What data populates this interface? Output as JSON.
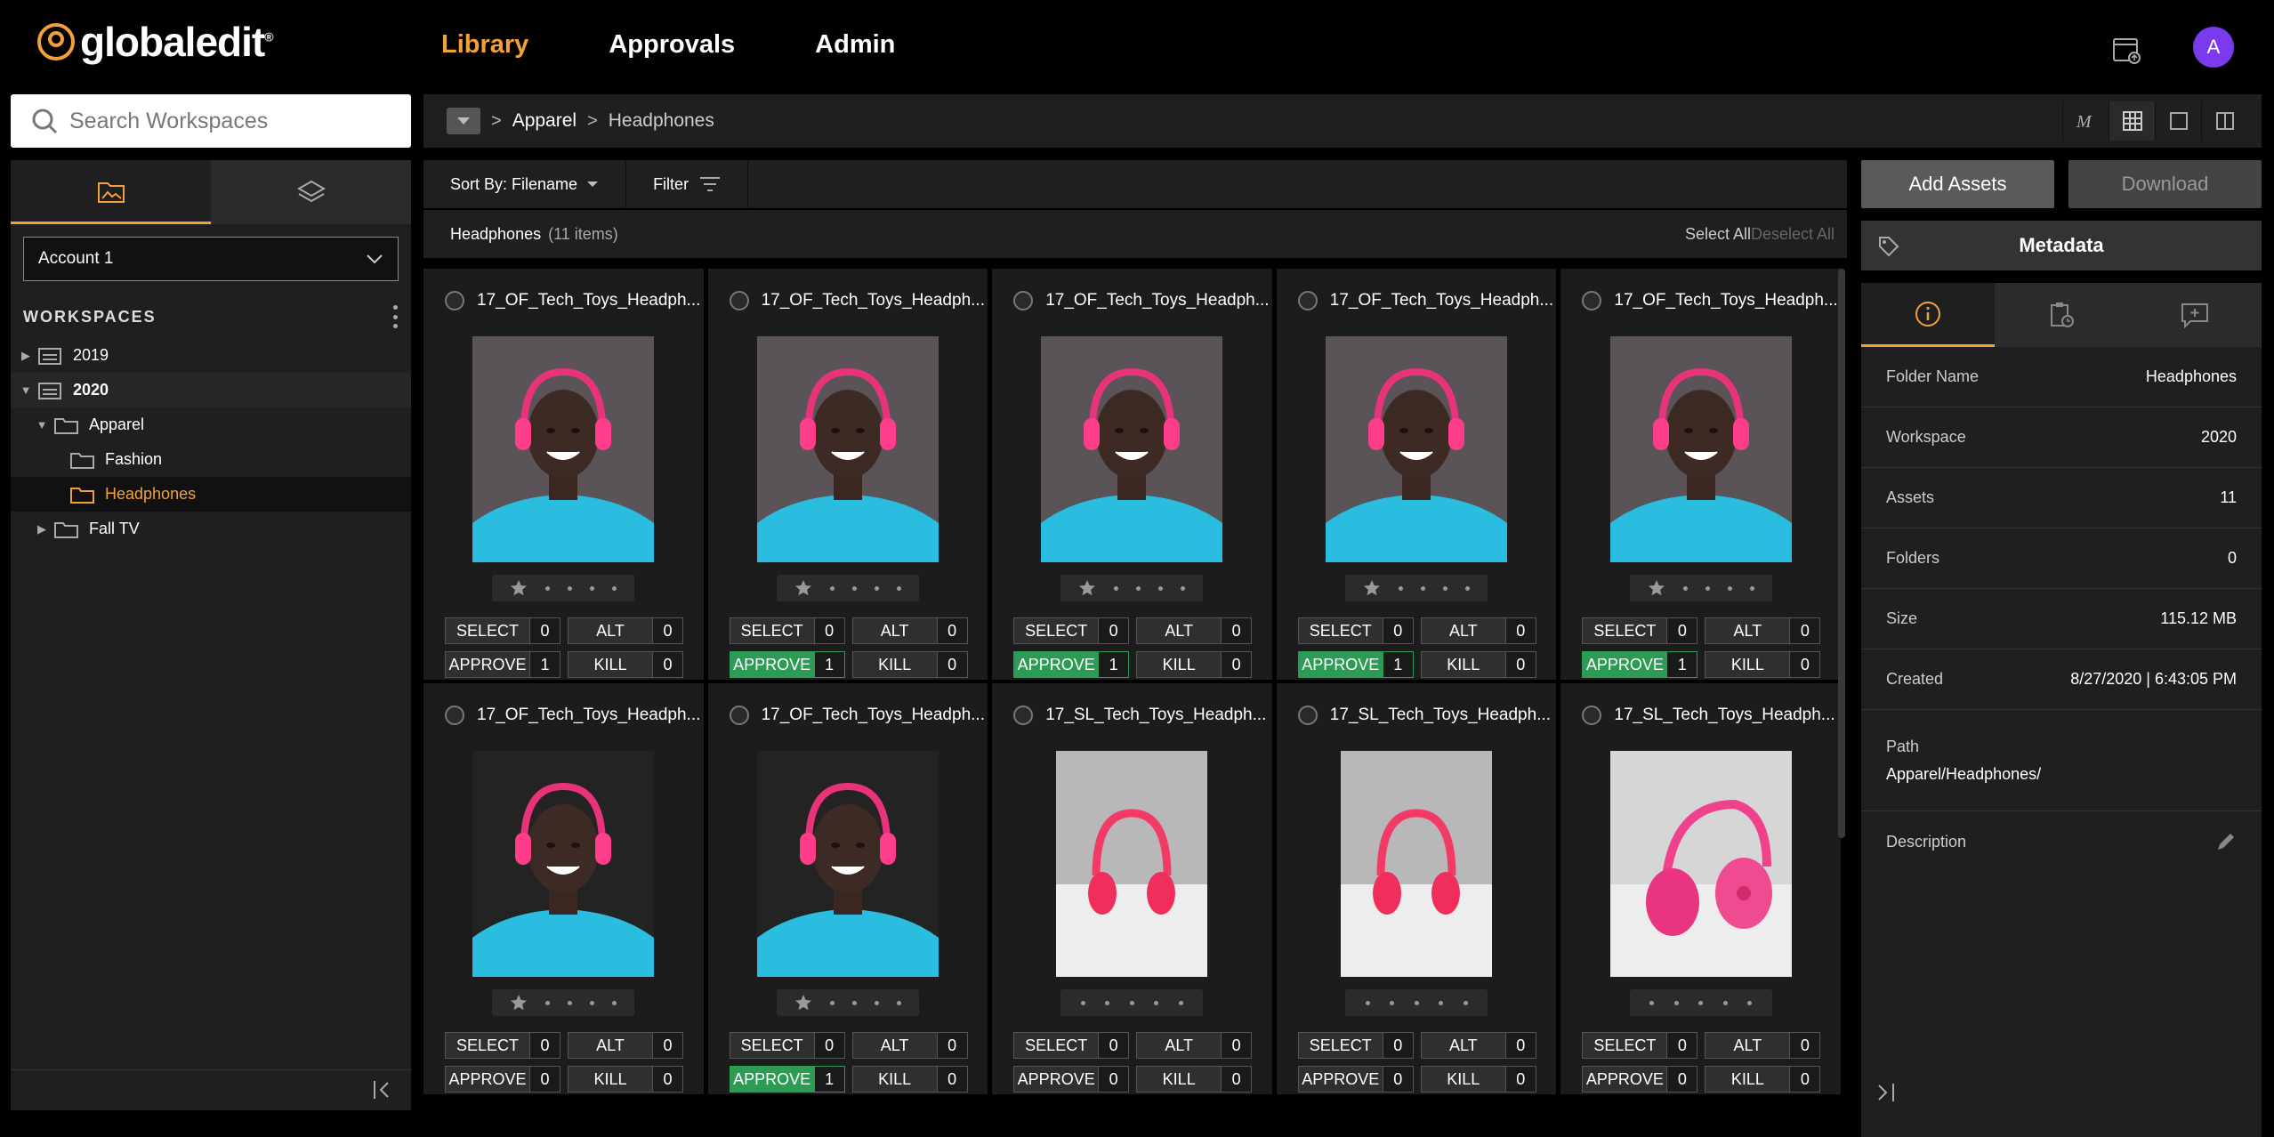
{
  "brand": {
    "name": "globaledit",
    "reg": "®",
    "accent": "#f2a13a"
  },
  "nav": {
    "items": [
      {
        "label": "Library",
        "active": true
      },
      {
        "label": "Approvals"
      },
      {
        "label": "Admin"
      }
    ]
  },
  "user": {
    "initial": "A",
    "color": "#7c3aed"
  },
  "search": {
    "placeholder": "Search Workspaces"
  },
  "sidebar": {
    "account": "Account 1",
    "workspaces_title": "WORKSPACES",
    "tree": [
      {
        "label": "2019",
        "level": 0,
        "caret": "right",
        "icon": "workspace-icon"
      },
      {
        "label": "2020",
        "level": 0,
        "caret": "down",
        "icon": "workspace-icon"
      },
      {
        "label": "Apparel",
        "level": 1,
        "caret": "down",
        "icon": "folder-open-icon"
      },
      {
        "label": "Fashion",
        "level": 2,
        "caret": "",
        "icon": "folder-icon"
      },
      {
        "label": "Headphones",
        "level": 2,
        "caret": "",
        "icon": "folder-icon",
        "selected": true
      },
      {
        "label": "Fall TV",
        "level": 1,
        "caret": "right",
        "icon": "folder-icon"
      }
    ]
  },
  "breadcrumb": {
    "sep": ">",
    "items": [
      "Apparel",
      "Headphones"
    ]
  },
  "toolbar": {
    "sort": "Sort By: Filename",
    "filter": "Filter"
  },
  "listing": {
    "title": "Headphones",
    "count": "(11 items)",
    "select_all": "Select All",
    "deselect_all": "Deselect All"
  },
  "assets": [
    {
      "name": "17_OF_Tech_Toys_Headph...",
      "type": "portrait",
      "star": true,
      "select": "0",
      "alt": "0",
      "approve": "1",
      "kill": "0",
      "approved": false
    },
    {
      "name": "17_OF_Tech_Toys_Headph...",
      "type": "portrait",
      "star": true,
      "select": "0",
      "alt": "0",
      "approve": "1",
      "kill": "0",
      "approved": true
    },
    {
      "name": "17_OF_Tech_Toys_Headph...",
      "type": "portrait",
      "star": true,
      "select": "0",
      "alt": "0",
      "approve": "1",
      "kill": "0",
      "approved": true
    },
    {
      "name": "17_OF_Tech_Toys_Headph...",
      "type": "portrait",
      "star": true,
      "select": "0",
      "alt": "0",
      "approve": "1",
      "kill": "0",
      "approved": true
    },
    {
      "name": "17_OF_Tech_Toys_Headph...",
      "type": "portrait",
      "star": true,
      "select": "0",
      "alt": "0",
      "approve": "1",
      "kill": "0",
      "approved": true
    },
    {
      "name": "17_OF_Tech_Toys_Headph...",
      "type": "portrait-dark",
      "star": true,
      "select": "0",
      "alt": "0",
      "approve": "0",
      "kill": "0",
      "approved": false
    },
    {
      "name": "17_OF_Tech_Toys_Headph...",
      "type": "portrait-dark",
      "star": true,
      "select": "0",
      "alt": "0",
      "approve": "1",
      "kill": "0",
      "approved": true
    },
    {
      "name": "17_SL_Tech_Toys_Headph...",
      "type": "product",
      "star": false,
      "select": "0",
      "alt": "0",
      "approve": "0",
      "kill": "0",
      "approved": false
    },
    {
      "name": "17_SL_Tech_Toys_Headph...",
      "type": "product",
      "star": false,
      "select": "0",
      "alt": "0",
      "approve": "0",
      "kill": "0",
      "approved": false
    },
    {
      "name": "17_SL_Tech_Toys_Headph...",
      "type": "product-side",
      "star": false,
      "select": "0",
      "alt": "0",
      "approve": "0",
      "kill": "0",
      "approved": false
    }
  ],
  "labels": {
    "select": "SELECT",
    "alt": "ALT",
    "approve": "APPROVE",
    "kill": "KILL"
  },
  "actions": {
    "add": "Add Assets",
    "download": "Download"
  },
  "metadata": {
    "title": "Metadata",
    "rows": [
      {
        "k": "Folder Name",
        "v": "Headphones"
      },
      {
        "k": "Workspace",
        "v": "2020"
      },
      {
        "k": "Assets",
        "v": "11"
      },
      {
        "k": "Folders",
        "v": "0"
      },
      {
        "k": "Size",
        "v": "115.12 MB"
      },
      {
        "k": "Created",
        "v": "8/27/2020 | 6:43:05 PM"
      }
    ],
    "path_label": "Path",
    "path_value": "Apparel/Headphones/",
    "desc_label": "Description"
  }
}
